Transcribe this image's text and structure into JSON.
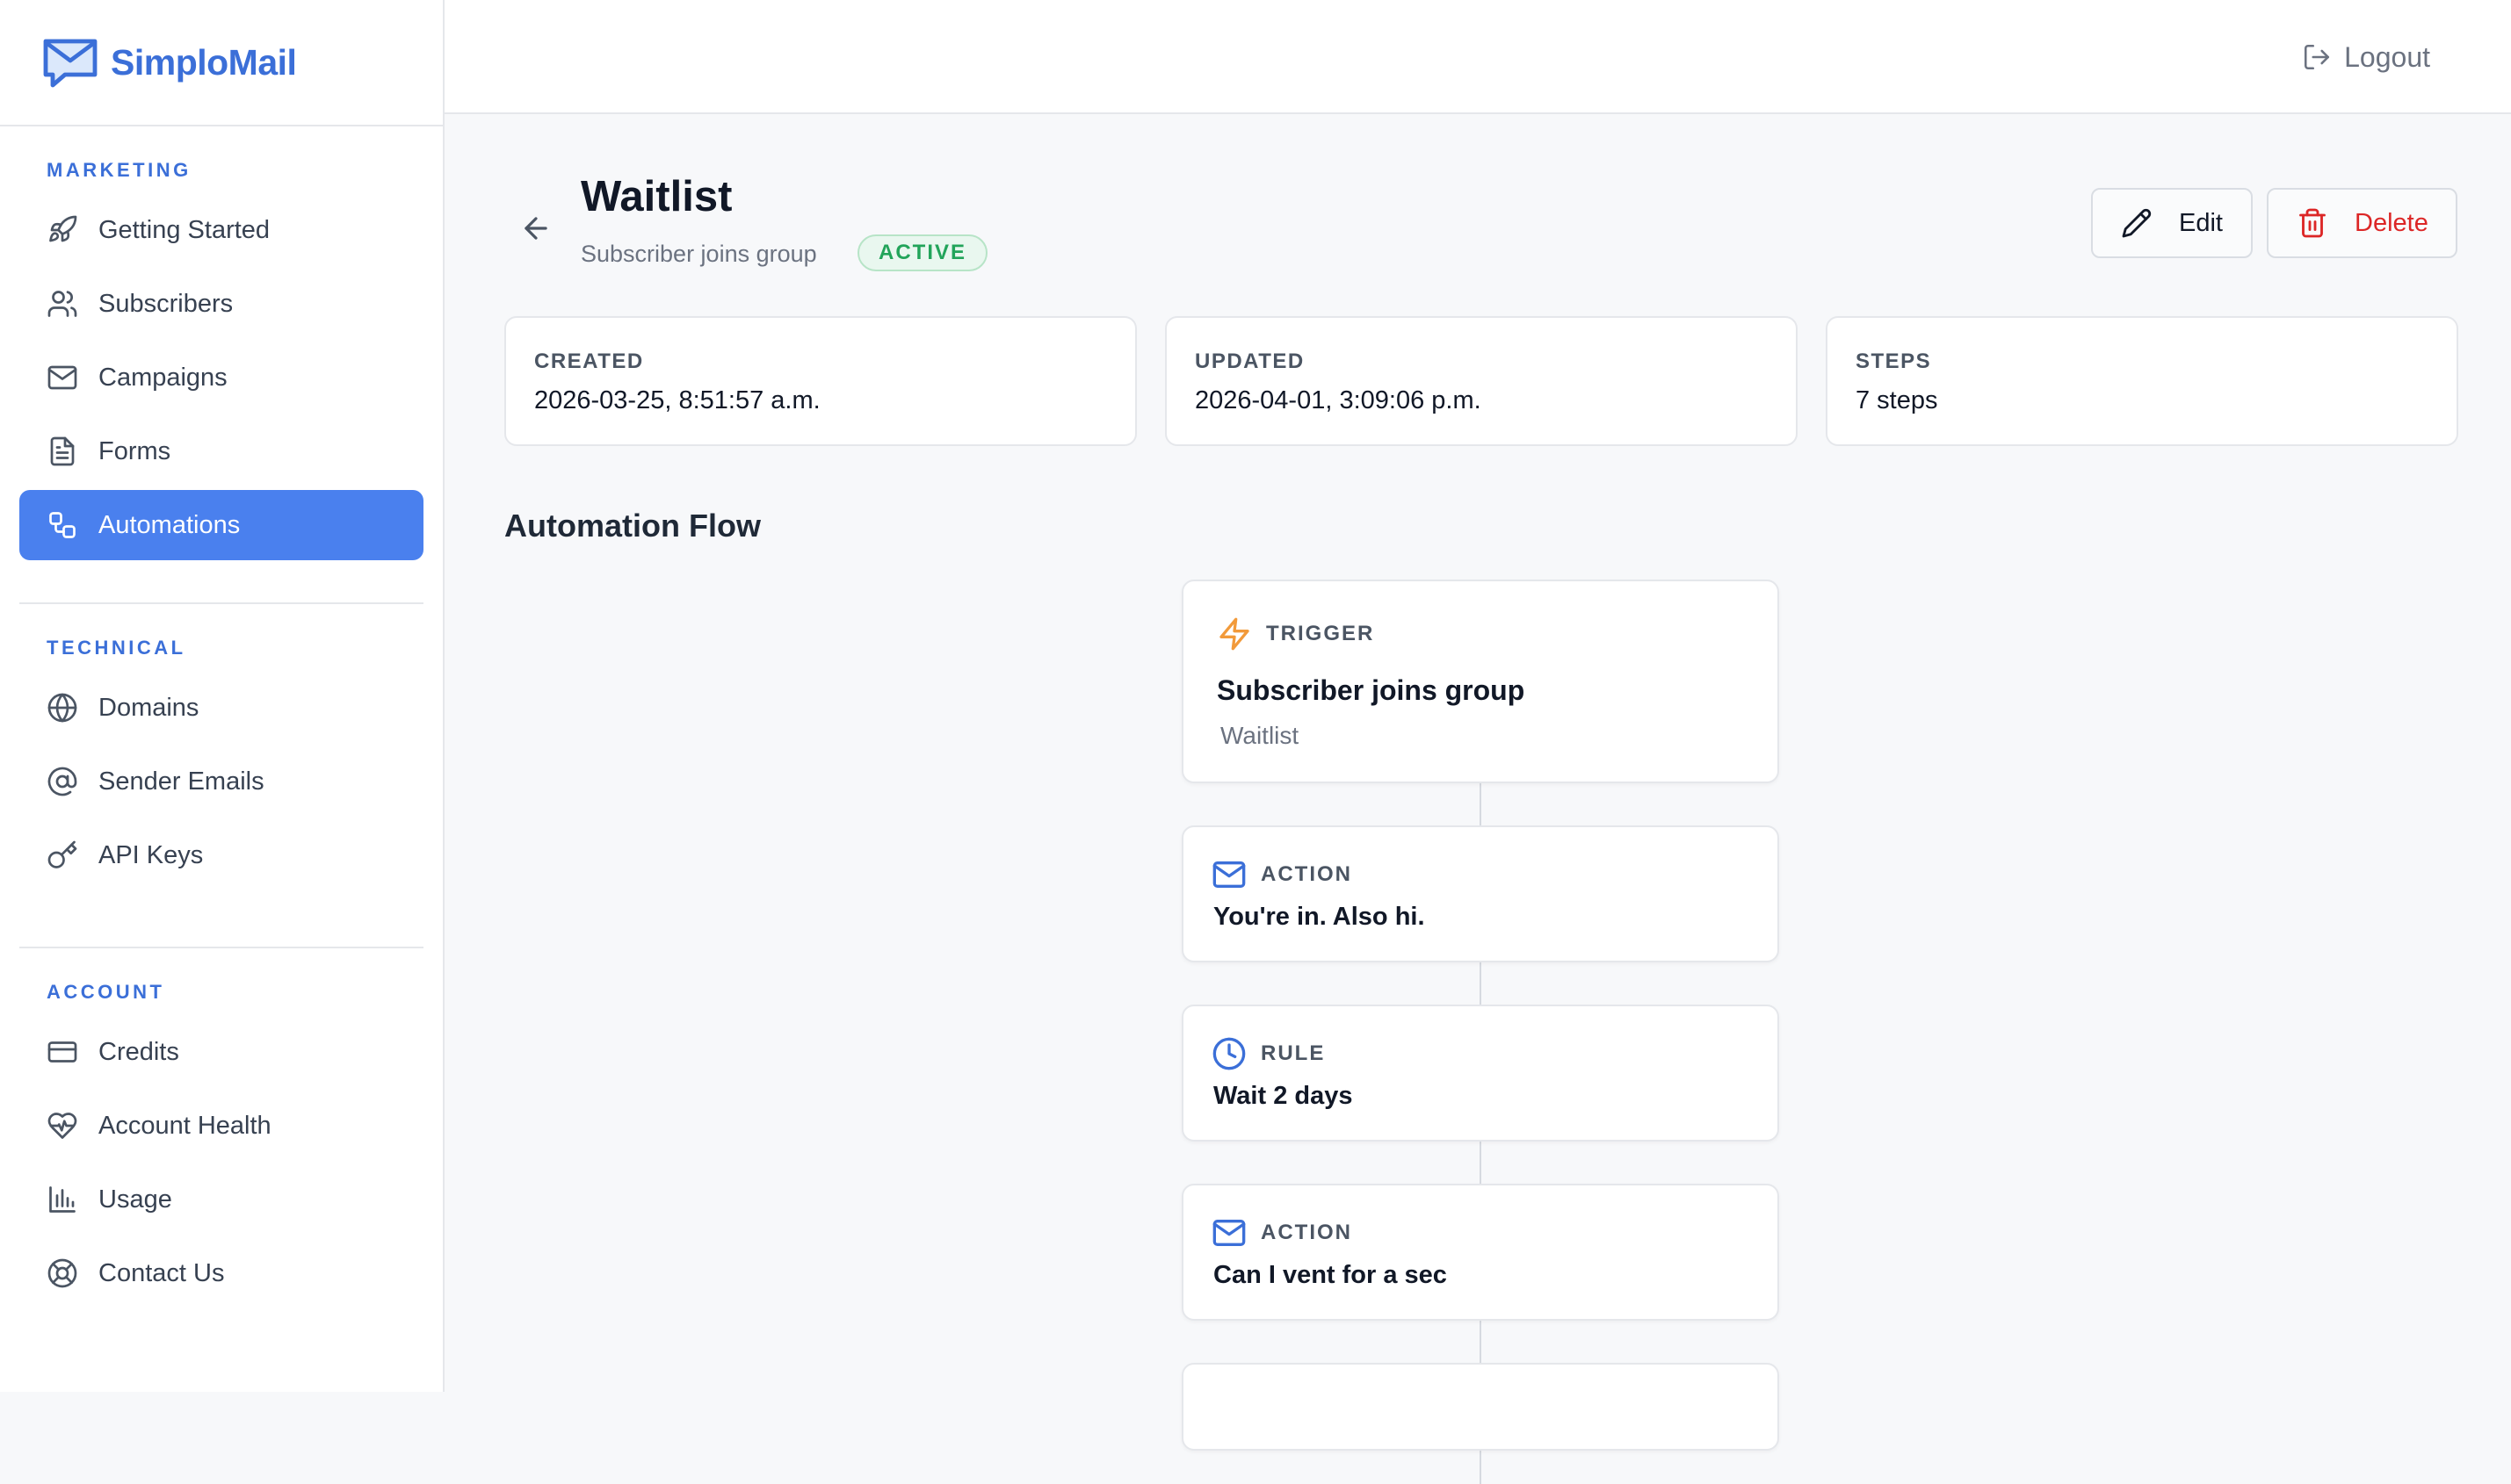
{
  "brand": {
    "name": "SimploMail",
    "color": "#3b6fd8"
  },
  "topbar": {
    "logout_label": "Logout"
  },
  "sidebar": {
    "sections": [
      {
        "title": "MARKETING",
        "items": [
          {
            "label": "Getting Started",
            "icon": "rocket-icon"
          },
          {
            "label": "Subscribers",
            "icon": "users-icon"
          },
          {
            "label": "Campaigns",
            "icon": "mail-icon"
          },
          {
            "label": "Forms",
            "icon": "document-icon"
          },
          {
            "label": "Automations",
            "icon": "workflow-icon",
            "active": true
          }
        ]
      },
      {
        "title": "TECHNICAL",
        "items": [
          {
            "label": "Domains",
            "icon": "globe-icon"
          },
          {
            "label": "Sender Emails",
            "icon": "at-sign-icon"
          },
          {
            "label": "API Keys",
            "icon": "key-icon"
          }
        ]
      },
      {
        "title": "ACCOUNT",
        "items": [
          {
            "label": "Credits",
            "icon": "credit-card-icon"
          },
          {
            "label": "Account Health",
            "icon": "heart-pulse-icon"
          },
          {
            "label": "Usage",
            "icon": "bar-chart-icon"
          },
          {
            "label": "Contact Us",
            "icon": "lifebuoy-icon"
          }
        ]
      }
    ]
  },
  "automation": {
    "name": "Waitlist",
    "trigger_summary": "Subscriber joins group",
    "status": "ACTIVE",
    "edit_label": "Edit",
    "delete_label": "Delete",
    "stats": [
      {
        "key": "CREATED",
        "value": "2026-03-25, 8:51:57 a.m."
      },
      {
        "key": "UPDATED",
        "value": "2026-04-01, 3:09:06 p.m."
      },
      {
        "key": "STEPS",
        "value": "7 steps"
      }
    ]
  },
  "flow": {
    "title": "Automation Flow",
    "steps": [
      {
        "type": "TRIGGER",
        "icon": "lightning-icon",
        "name": "Subscriber joins group",
        "detail": "Waitlist"
      },
      {
        "type": "ACTION",
        "icon": "mail-icon",
        "name": "You're in. Also hi."
      },
      {
        "type": "RULE",
        "icon": "clock-icon",
        "name": "Wait 2 days"
      },
      {
        "type": "ACTION",
        "icon": "mail-icon",
        "name": "Can I vent for a sec"
      }
    ]
  },
  "colors": {
    "accent": "#4a80ee",
    "active_badge": "#22a45a",
    "danger": "#dc2626",
    "trigger": "#f29a3a"
  }
}
